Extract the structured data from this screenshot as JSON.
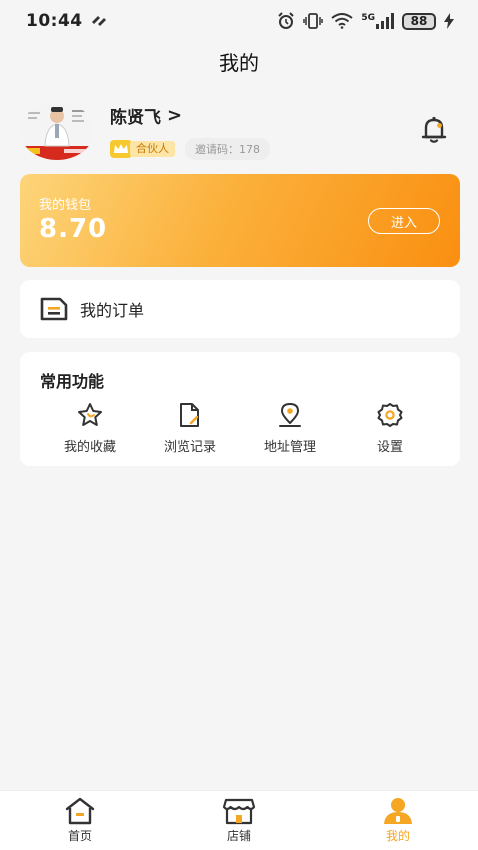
{
  "status_bar": {
    "time": "10:44",
    "network": "5G",
    "battery": "88"
  },
  "header": {
    "title": "我的"
  },
  "profile": {
    "name": "陈贤飞",
    "chevron": ">",
    "badge_label": "合伙人",
    "invite_code": "邀请码：178"
  },
  "wallet": {
    "label": "我的钱包",
    "amount": "8.70",
    "enter_label": "进入",
    "gradient_start": "#fdd57a",
    "gradient_end": "#fa8f11"
  },
  "orders": {
    "label": "我的订单"
  },
  "features": {
    "title": "常用功能",
    "items": [
      {
        "label": "我的收藏",
        "icon": "star-icon"
      },
      {
        "label": "浏览记录",
        "icon": "history-document-icon"
      },
      {
        "label": "地址管理",
        "icon": "location-pin-icon"
      },
      {
        "label": "设置",
        "icon": "gear-icon"
      }
    ]
  },
  "tabbar": {
    "items": [
      {
        "label": "首页",
        "icon": "home-icon",
        "active": false
      },
      {
        "label": "店铺",
        "icon": "store-icon",
        "active": false
      },
      {
        "label": "我的",
        "icon": "user-icon",
        "active": true
      }
    ],
    "accent": "#f5a623"
  }
}
